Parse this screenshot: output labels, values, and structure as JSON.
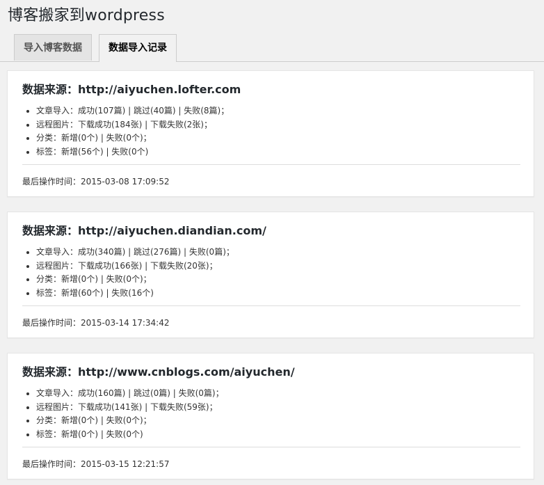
{
  "page": {
    "title": "博客搬家到wordpress"
  },
  "tabs": [
    {
      "label": "导入博客数据",
      "active": false
    },
    {
      "label": "数据导入记录",
      "active": true
    }
  ],
  "records": [
    {
      "source_label": "数据来源：",
      "source_url": "http://aiyuchen.lofter.com",
      "items": [
        "文章导入：成功(107篇) | 跳过(40篇) | 失败(8篇)；",
        "远程图片：下载成功(184张) | 下载失败(2张)；",
        "分类：新增(0个) | 失败(0个)；",
        "标签：新增(56个) | 失败(0个)"
      ],
      "time_label": "最后操作时间：",
      "time": "2015-03-08 17:09:52"
    },
    {
      "source_label": "数据来源：",
      "source_url": "http://aiyuchen.diandian.com/",
      "items": [
        "文章导入：成功(340篇) | 跳过(276篇) | 失败(0篇)；",
        "远程图片：下载成功(166张) | 下载失败(20张)；",
        "分类：新增(0个) | 失败(0个)；",
        "标签：新增(60个) | 失败(16个)"
      ],
      "time_label": "最后操作时间：",
      "time": "2015-03-14 17:34:42"
    },
    {
      "source_label": "数据来源：",
      "source_url": "http://www.cnblogs.com/aiyuchen/",
      "items": [
        "文章导入：成功(160篇) | 跳过(0篇) | 失败(0篇)；",
        "远程图片：下载成功(141张) | 下载失败(59张)；",
        "分类：新增(0个) | 失败(0个)；",
        "标签：新增(0个) | 失败(0个)"
      ],
      "time_label": "最后操作时间：",
      "time": "2015-03-15 12:21:57"
    }
  ]
}
